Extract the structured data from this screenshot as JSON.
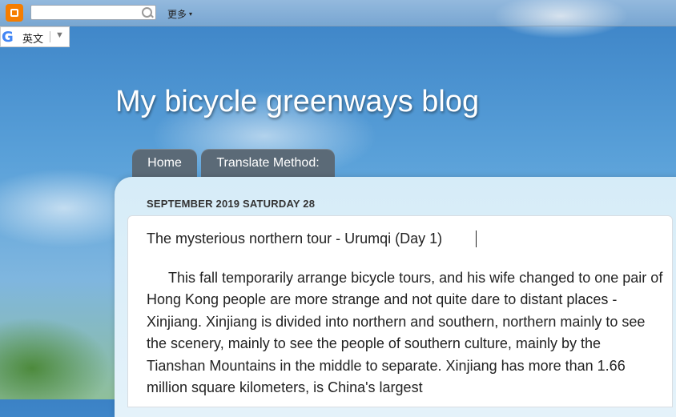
{
  "navbar": {
    "logo_icon": "blogger-logo-icon",
    "search": {
      "value": "",
      "placeholder": ""
    },
    "more_label": "更多",
    "more_arrow": "▾"
  },
  "translate_widget": {
    "icon": "google-g-icon",
    "icon_glyph": "G",
    "language": "英文",
    "dropdown_arrow": "▼"
  },
  "blog": {
    "title": "My bicycle greenways blog"
  },
  "tabs": [
    {
      "label": "Home"
    },
    {
      "label": "Translate Method:"
    }
  ],
  "post": {
    "date": "SEPTEMBER 2019 SATURDAY 28",
    "title": "The mysterious northern tour - Urumqi (Day 1)",
    "body": "This fall temporarily arrange bicycle tours, and his wife changed to one pair of Hong Kong people are more strange and not quite dare to distant places - Xinjiang. Xinjiang is divided into northern and southern, northern mainly to see the scenery, mainly to see the people of southern culture, mainly by the Tianshan Mountains in the middle to separate. Xinjiang has more than 1.66 million square kilometers, is China's largest"
  },
  "colors": {
    "tab_bg": "#5b6a77",
    "logo_orange": "#f57d00",
    "panel_bg": "#d6ecf8"
  }
}
